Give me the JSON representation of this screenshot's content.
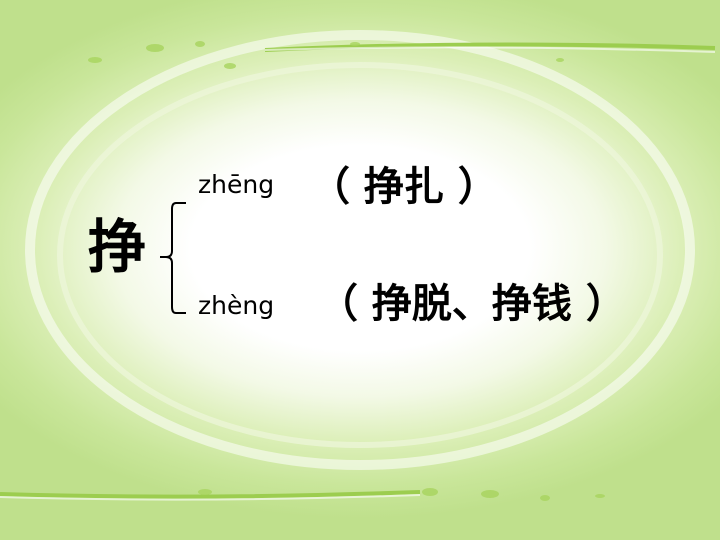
{
  "slide": {
    "main_char": "挣",
    "readings": [
      {
        "pinyin": "zhēng",
        "words": "（ 挣扎 ）"
      },
      {
        "pinyin": "zhèng",
        "words": "（ 挣脱、挣钱 ）"
      }
    ]
  },
  "colors": {
    "text": "#000000",
    "background_green": "#c9e69a",
    "accent_green": "#8cc63f"
  }
}
